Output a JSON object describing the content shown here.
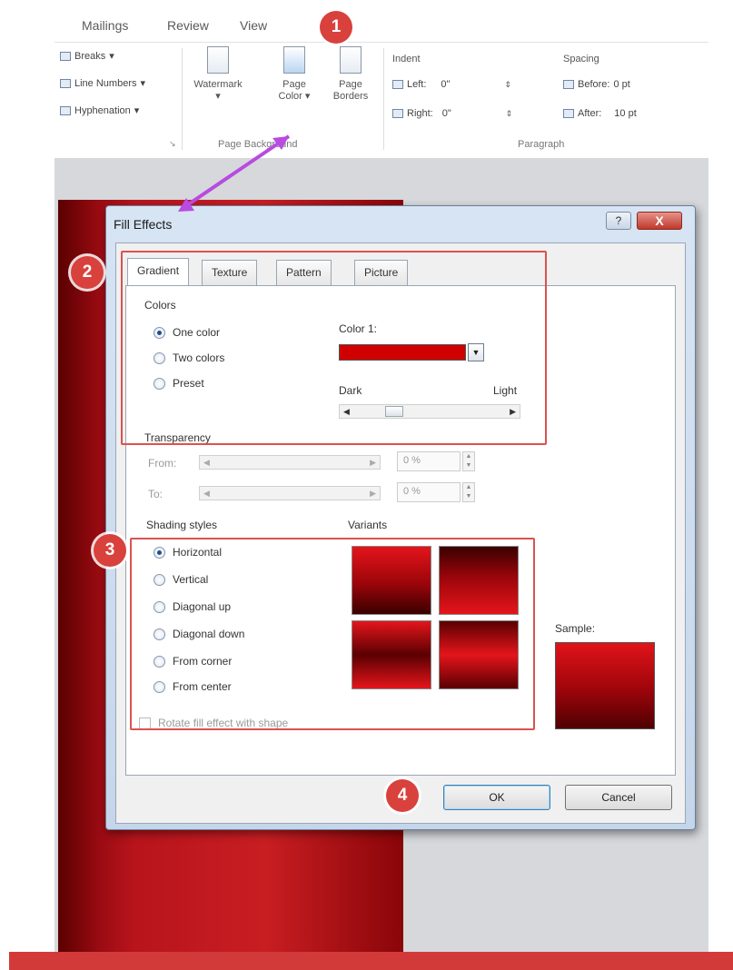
{
  "ribbon": {
    "tabs": [
      "Mailings",
      "Review",
      "View"
    ],
    "page_setup": {
      "breaks": "Breaks",
      "line_numbers": "Line Numbers",
      "hyphenation": "Hyphenation"
    },
    "page_background": {
      "watermark": "Watermark",
      "page_color_1": "Page",
      "page_color_2": "Color",
      "page_borders_1": "Page",
      "page_borders_2": "Borders",
      "group_label": "Page Background"
    },
    "paragraph": {
      "indent_header": "Indent",
      "spacing_header": "Spacing",
      "left_label": "Left:",
      "left_value": "0\"",
      "right_label": "Right:",
      "right_value": "0\"",
      "before_label": "Before:",
      "before_value": "0 pt",
      "after_label": "After:",
      "after_value": "10 pt",
      "group_label": "Paragraph"
    }
  },
  "dialog": {
    "title": "Fill Effects",
    "help": "?",
    "close": "X",
    "tabs": [
      "Gradient",
      "Texture",
      "Pattern",
      "Picture"
    ],
    "colors": {
      "header": "Colors",
      "options": [
        "One color",
        "Two colors",
        "Preset"
      ],
      "selected": "One color",
      "color1_label": "Color 1:",
      "dark_label": "Dark",
      "light_label": "Light"
    },
    "transparency": {
      "header": "Transparency",
      "from_label": "From:",
      "from_value": "0 %",
      "to_label": "To:",
      "to_value": "0 %"
    },
    "shading": {
      "header": "Shading styles",
      "options": [
        "Horizontal",
        "Vertical",
        "Diagonal up",
        "Diagonal down",
        "From corner",
        "From center"
      ],
      "selected": "Horizontal"
    },
    "variants_label": "Variants",
    "sample_label": "Sample:",
    "rotate_label": "Rotate fill effect with shape",
    "ok": "OK",
    "cancel": "Cancel"
  },
  "annotations": [
    "1",
    "2",
    "3",
    "4"
  ],
  "colors": {
    "fill_color": "#d10000",
    "highlight": "#d9534f",
    "arrow": "#b84be0"
  }
}
